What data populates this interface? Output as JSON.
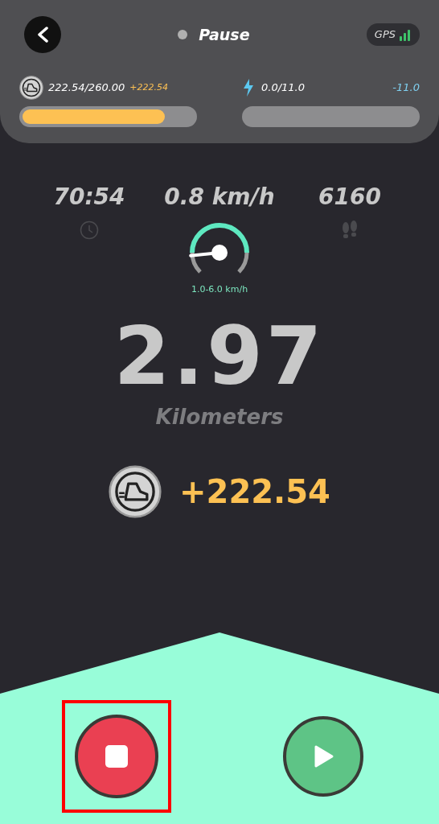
{
  "header": {
    "status": {
      "label": "Pause",
      "color": "#b0b0b0"
    },
    "gps": {
      "label": "GPS"
    }
  },
  "coin_bar": {
    "reading": "222.54/260.00",
    "gain": "+222.54",
    "level": 0.83
  },
  "energy_bar": {
    "reading": "0.0/11.0",
    "change": "-11.0"
  },
  "stats": [
    {
      "kind": "time",
      "value": "70:54"
    },
    {
      "kind": "speed",
      "value": "0.8 km/h",
      "range": "1.0-6.0 km/h"
    },
    {
      "kind": "steps",
      "value": "6160"
    }
  ],
  "distance": {
    "value": "2.97",
    "unit": "Kilometers"
  },
  "earned": "+222.54",
  "controls": [
    {
      "kind": "stop",
      "highlighted": true
    },
    {
      "kind": "play",
      "highlighted": false
    }
  ]
}
